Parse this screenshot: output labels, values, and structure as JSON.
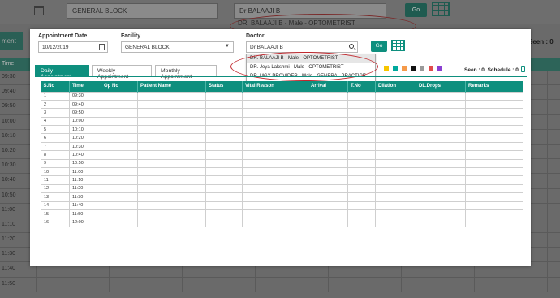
{
  "background": {
    "facility_select": "GENERAL BLOCK",
    "doctor_select": "Dr BALAAJI B",
    "go_label": "Go",
    "dropdown_hint": "DR. BALAAJI B - Male - OPTOMETRIST",
    "left_button": "ment",
    "seen_label": "Seen : 0",
    "time_header": "Time",
    "times": [
      "09:30",
      "09:40",
      "09:50",
      "10:00",
      "10:10",
      "10:20",
      "10:30",
      "10:40",
      "10:50",
      "11:00",
      "11:10",
      "11:20",
      "11:30",
      "11:40",
      "11:50"
    ]
  },
  "form": {
    "date_label": "Appointment Date",
    "date_value": "10/12/2019",
    "facility_label": "Facility",
    "facility_value": "GENERAL BLOCK",
    "doctor_label": "Doctor",
    "doctor_value": "Dr BALAAJI B",
    "go_label": "Go"
  },
  "doctor_dropdown": [
    "DR. BALAAJI B - Male - OPTOMETRIST",
    "DR. Jeya Lakshmi - Male - OPTOMETRIST",
    "DR. MGX PROVIDER - Male - GENERAL PRACTICE"
  ],
  "tabs": [
    "Daily Appointment",
    "Weekly Appointment",
    "Monthly Appointment"
  ],
  "status_colors": [
    "#f7c600",
    "#00a99d",
    "#f59a4a",
    "#111111",
    "#9a9a9a",
    "#e14b4b",
    "#8a3fd1"
  ],
  "counts": {
    "seen": "Seen : 0",
    "schedule": "Schedule : 0"
  },
  "table": {
    "columns": [
      "S.No",
      "Time",
      "Op No",
      "Patient Name",
      "Status",
      "Vital Reason",
      "Arrival",
      "T.No",
      "Dilation",
      "DL.Drops",
      "Remarks"
    ],
    "rows": [
      [
        "1",
        "09:30"
      ],
      [
        "2",
        "09:40"
      ],
      [
        "3",
        "09:50"
      ],
      [
        "4",
        "10:00"
      ],
      [
        "5",
        "10:10"
      ],
      [
        "6",
        "10:20"
      ],
      [
        "7",
        "10:30"
      ],
      [
        "8",
        "10:40"
      ],
      [
        "9",
        "10:50"
      ],
      [
        "10",
        "11:00"
      ],
      [
        "11",
        "11:10"
      ],
      [
        "12",
        "11:20"
      ],
      [
        "13",
        "11:30"
      ],
      [
        "14",
        "11:40"
      ],
      [
        "15",
        "11:50"
      ],
      [
        "16",
        "12:00"
      ]
    ]
  }
}
